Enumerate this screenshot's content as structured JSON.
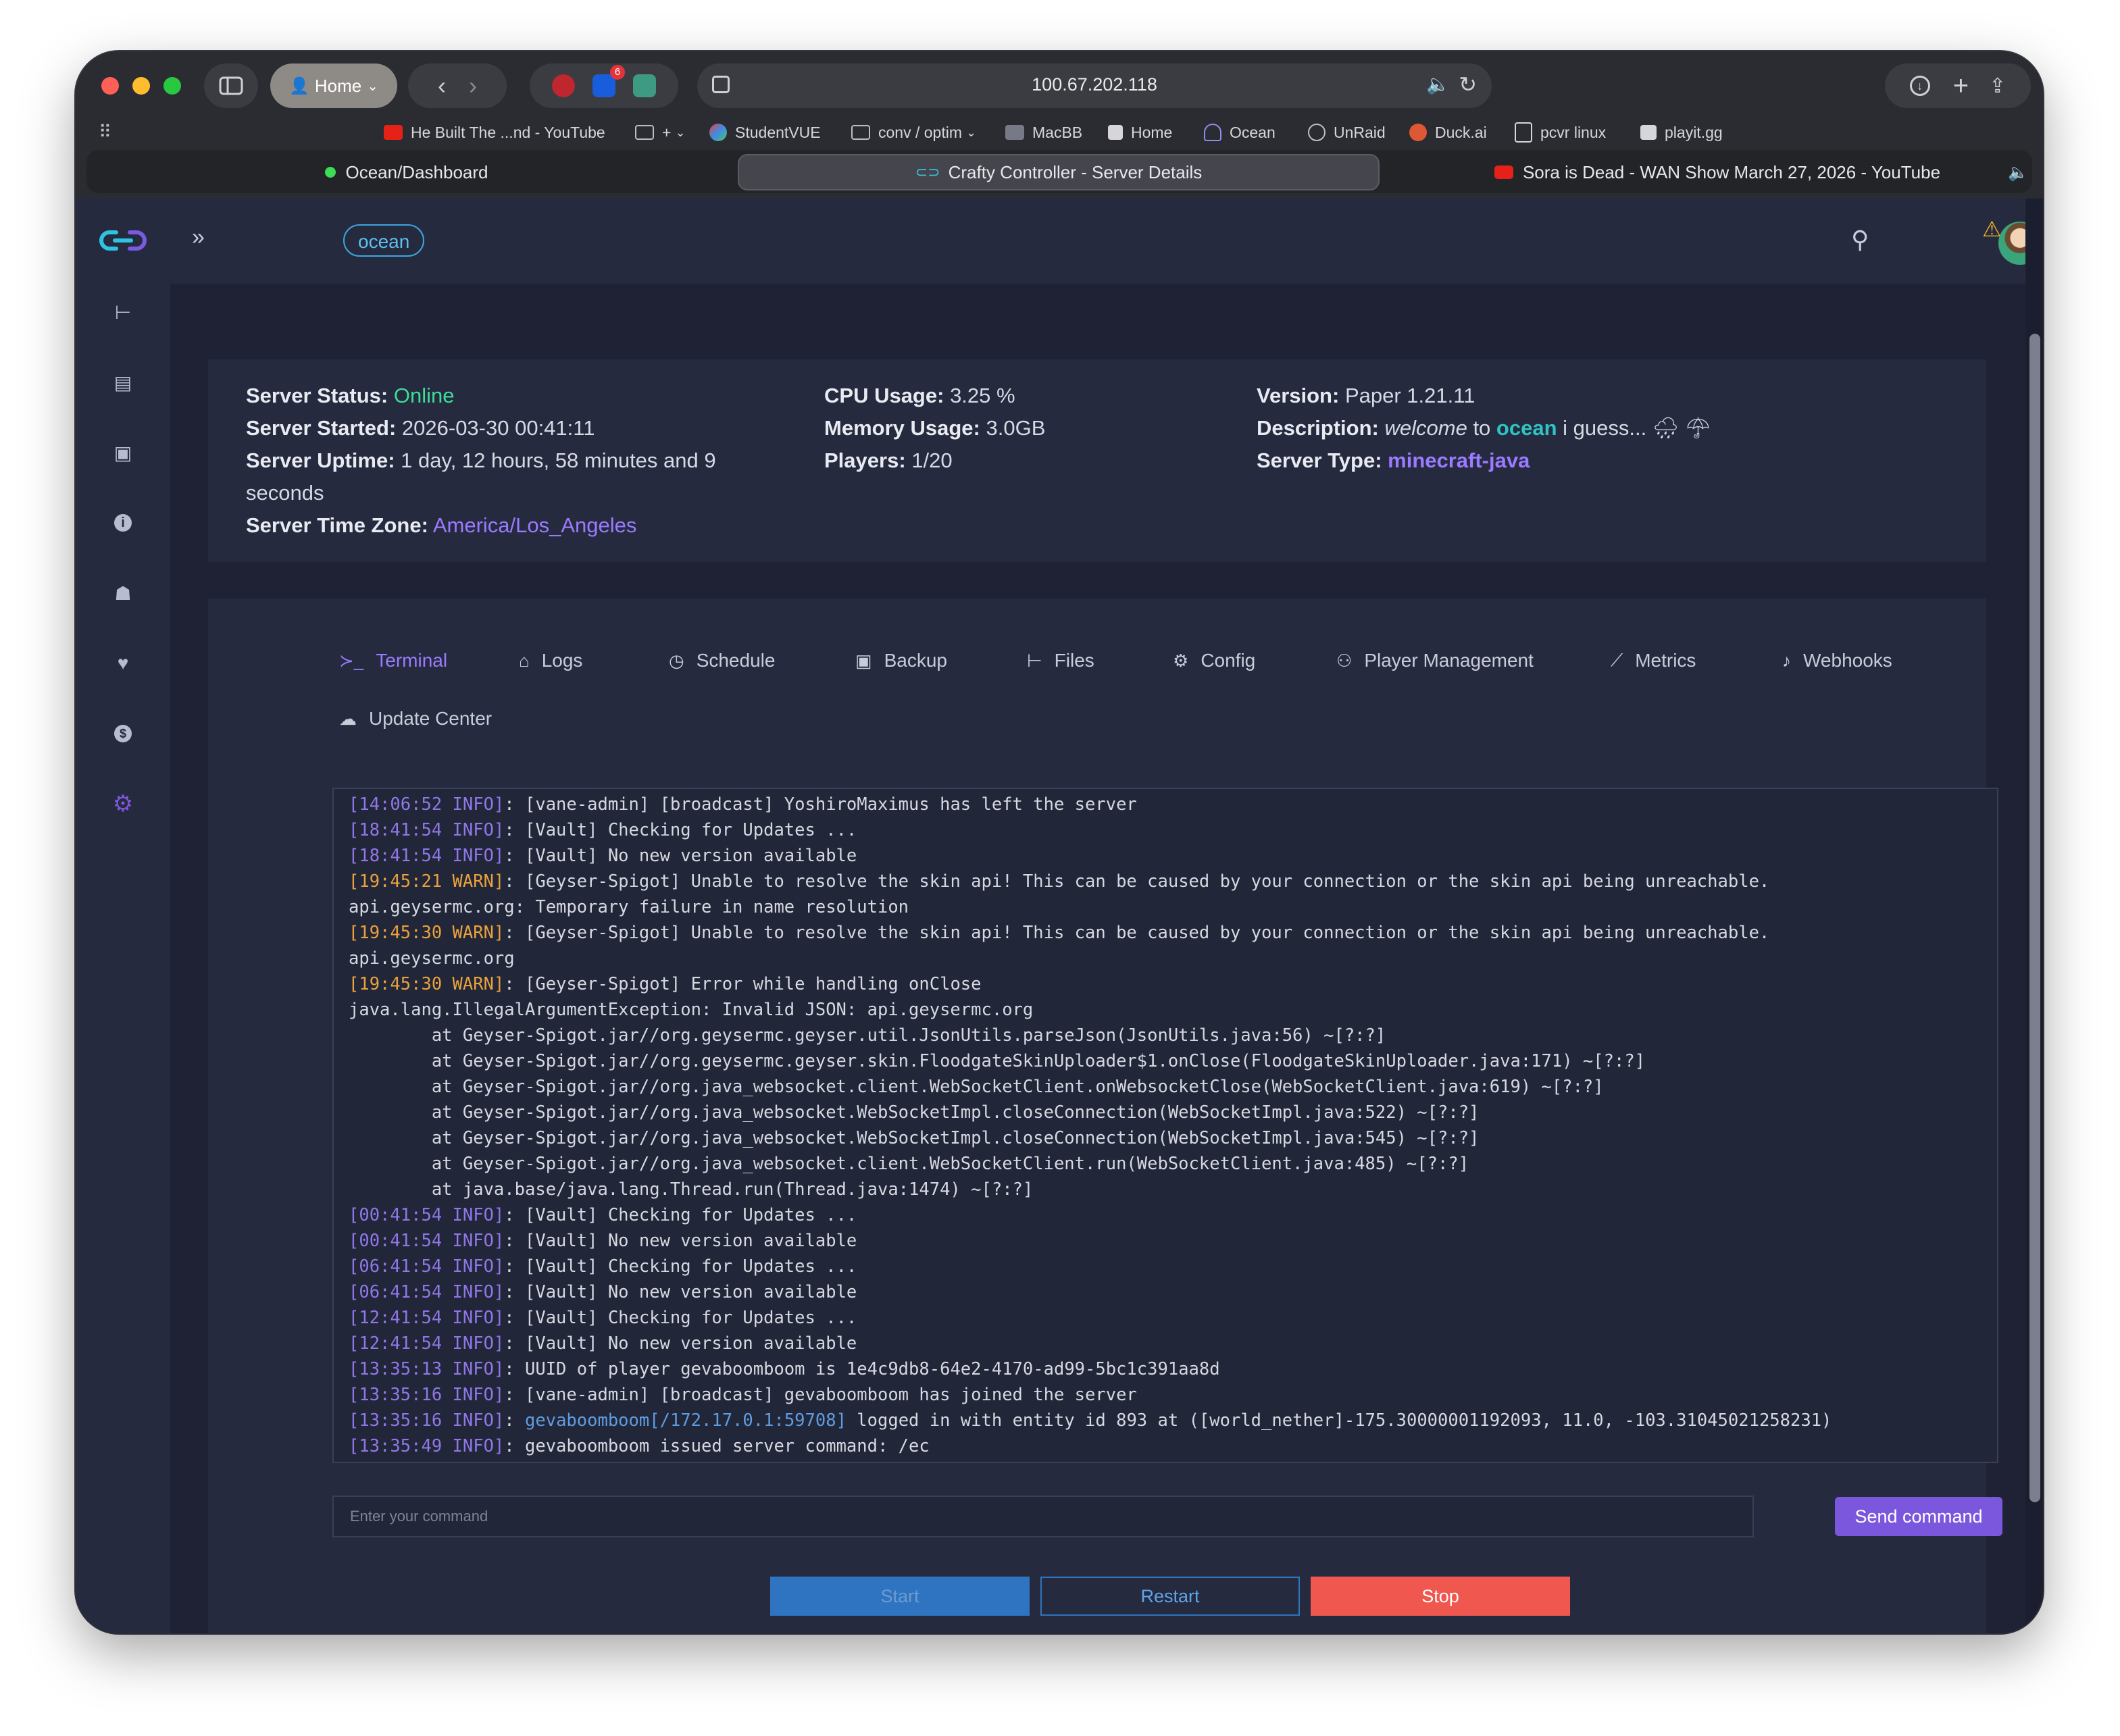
{
  "browser": {
    "url": "100.67.202.118",
    "profile_label": "Home",
    "extension_badge": "6",
    "bookmarks": [
      {
        "label": "He Built The ...nd - YouTube",
        "icon": "youtube-icon"
      },
      {
        "label": "+",
        "icon": "folder-icon"
      },
      {
        "label": "StudentVUE",
        "icon": "studentvue-icon"
      },
      {
        "label": "conv / optim",
        "icon": "folder-icon"
      },
      {
        "label": "MacBB",
        "icon": "macbb-icon"
      },
      {
        "label": "Home",
        "icon": "home-dashboard-icon"
      },
      {
        "label": "Ocean",
        "icon": "ocean-icon"
      },
      {
        "label": "UnRaid",
        "icon": "globe-icon"
      },
      {
        "label": "Duck.ai",
        "icon": "duckduckgo-icon"
      },
      {
        "label": "pcvr linux",
        "icon": "document-icon"
      },
      {
        "label": "playit.gg",
        "icon": "playit-icon"
      }
    ],
    "tabs": [
      {
        "label": "Ocean/Dashboard",
        "active": false
      },
      {
        "label": "Crafty Controller - Server Details",
        "active": true
      },
      {
        "label": "Sora is Dead - WAN Show March 27, 2026 - YouTube",
        "active": false
      }
    ]
  },
  "header": {
    "server_name_badge": "ocean"
  },
  "server_info": {
    "status_label": "Server Status:",
    "status_value": "Online",
    "started_label": "Server Started:",
    "started_value": "2026-03-30 00:41:11",
    "uptime_label": "Server Uptime:",
    "uptime_value": "1 day, 12 hours, 58 minutes and 9",
    "uptime_value_cont": "seconds",
    "timezone_label": "Server Time Zone:",
    "timezone_value": "America/Los_Angeles",
    "cpu_label": "CPU Usage:",
    "cpu_value": "3.25 %",
    "memory_label": "Memory Usage:",
    "memory_value": "3.0GB",
    "players_label": "Players:",
    "players_value": "1/20",
    "version_label": "Version:",
    "version_value": "Paper 1.21.11",
    "description_label": "Description:",
    "description_part1": "welcome",
    "description_part2": "to",
    "description_part3": "ocean",
    "description_part4": "i guess...",
    "description_emoji": "🌧 ☂",
    "type_label": "Server Type:",
    "type_value": "minecraft-java"
  },
  "nav_tabs": [
    {
      "label": "Terminal",
      "icon": "terminal-icon",
      "active": true
    },
    {
      "label": "Logs",
      "icon": "logs-icon",
      "active": false
    },
    {
      "label": "Schedule",
      "icon": "clock-icon",
      "active": false
    },
    {
      "label": "Backup",
      "icon": "save-icon",
      "active": false
    },
    {
      "label": "Files",
      "icon": "tree-icon",
      "active": false
    },
    {
      "label": "Config",
      "icon": "gear-icon",
      "active": false
    },
    {
      "label": "Player Management",
      "icon": "users-icon",
      "active": false
    },
    {
      "label": "Metrics",
      "icon": "chart-icon",
      "active": false
    },
    {
      "label": "Webhooks",
      "icon": "bell-icon",
      "active": false
    },
    {
      "label": "Update Center",
      "icon": "cloud-icon",
      "active": false
    }
  ],
  "terminal": {
    "lines": [
      {
        "ts": "[14:06:52 INFO]",
        "level": "info",
        "msg": ": [vane-admin] [broadcast] YoshiroMaximus has left the server"
      },
      {
        "ts": "[18:41:54 INFO]",
        "level": "info",
        "msg": ": [Vault] Checking for Updates ..."
      },
      {
        "ts": "[18:41:54 INFO]",
        "level": "info",
        "msg": ": [Vault] No new version available"
      },
      {
        "ts": "[19:45:21 WARN]",
        "level": "warn",
        "msg": ": [Geyser-Spigot] Unable to resolve the skin api! This can be caused by your connection or the skin api being unreachable."
      },
      {
        "ts": "",
        "level": "plain",
        "msg": "api.geysermc.org: Temporary failure in name resolution"
      },
      {
        "ts": "[19:45:30 WARN]",
        "level": "warn",
        "msg": ": [Geyser-Spigot] Unable to resolve the skin api! This can be caused by your connection or the skin api being unreachable."
      },
      {
        "ts": "",
        "level": "plain",
        "msg": "api.geysermc.org"
      },
      {
        "ts": "[19:45:30 WARN]",
        "level": "warn",
        "msg": ": [Geyser-Spigot] Error while handling onClose"
      },
      {
        "ts": "",
        "level": "plain",
        "msg": "java.lang.IllegalArgumentException: Invalid JSON: api.geysermc.org"
      },
      {
        "ts": "",
        "level": "plain",
        "msg": "        at Geyser-Spigot.jar//org.geysermc.geyser.util.JsonUtils.parseJson(JsonUtils.java:56) ~[?:?]"
      },
      {
        "ts": "",
        "level": "plain",
        "msg": "        at Geyser-Spigot.jar//org.geysermc.geyser.skin.FloodgateSkinUploader$1.onClose(FloodgateSkinUploader.java:171) ~[?:?]"
      },
      {
        "ts": "",
        "level": "plain",
        "msg": "        at Geyser-Spigot.jar//org.java_websocket.client.WebSocketClient.onWebsocketClose(WebSocketClient.java:619) ~[?:?]"
      },
      {
        "ts": "",
        "level": "plain",
        "msg": "        at Geyser-Spigot.jar//org.java_websocket.WebSocketImpl.closeConnection(WebSocketImpl.java:522) ~[?:?]"
      },
      {
        "ts": "",
        "level": "plain",
        "msg": "        at Geyser-Spigot.jar//org.java_websocket.WebSocketImpl.closeConnection(WebSocketImpl.java:545) ~[?:?]"
      },
      {
        "ts": "",
        "level": "plain",
        "msg": "        at Geyser-Spigot.jar//org.java_websocket.client.WebSocketClient.run(WebSocketClient.java:485) ~[?:?]"
      },
      {
        "ts": "",
        "level": "plain",
        "msg": "        at java.base/java.lang.Thread.run(Thread.java:1474) ~[?:?]"
      },
      {
        "ts": "[00:41:54 INFO]",
        "level": "info",
        "msg": ": [Vault] Checking for Updates ..."
      },
      {
        "ts": "[00:41:54 INFO]",
        "level": "info",
        "msg": ": [Vault] No new version available"
      },
      {
        "ts": "[06:41:54 INFO]",
        "level": "info",
        "msg": ": [Vault] Checking for Updates ..."
      },
      {
        "ts": "[06:41:54 INFO]",
        "level": "info",
        "msg": ": [Vault] No new version available"
      },
      {
        "ts": "[12:41:54 INFO]",
        "level": "info",
        "msg": ": [Vault] Checking for Updates ..."
      },
      {
        "ts": "[12:41:54 INFO]",
        "level": "info",
        "msg": ": [Vault] No new version available"
      },
      {
        "ts": "[13:35:13 INFO]",
        "level": "info",
        "msg": ": UUID of player gevaboomboom is 1e4c9db8-64e2-4170-ad99-5bc1c391aa8d"
      },
      {
        "ts": "[13:35:16 INFO]",
        "level": "info",
        "msg": ": [vane-admin] [broadcast] gevaboomboom has joined the server"
      },
      {
        "ts": "[13:35:16 INFO]",
        "level": "info",
        "msg": ": ",
        "link": "gevaboomboom[/172.17.0.1:59708]",
        "msg2": " logged in with entity id 893 at ([world_nether]-175.30000001192093, 11.0, -103.31045021258231)"
      },
      {
        "ts": "[13:35:49 INFO]",
        "level": "info",
        "msg": ": gevaboomboom issued server command: /ec"
      }
    ]
  },
  "command": {
    "placeholder": "Enter your command",
    "send_label": "Send command"
  },
  "controls": {
    "start_label": "Start",
    "restart_label": "Restart",
    "stop_label": "Stop"
  },
  "colors": {
    "online": "#3ddc97",
    "accent_purple": "#9a7bff",
    "teal": "#2ec4c4",
    "start": "#2f74c0",
    "stop": "#f0574f",
    "send": "#7b57dd"
  }
}
